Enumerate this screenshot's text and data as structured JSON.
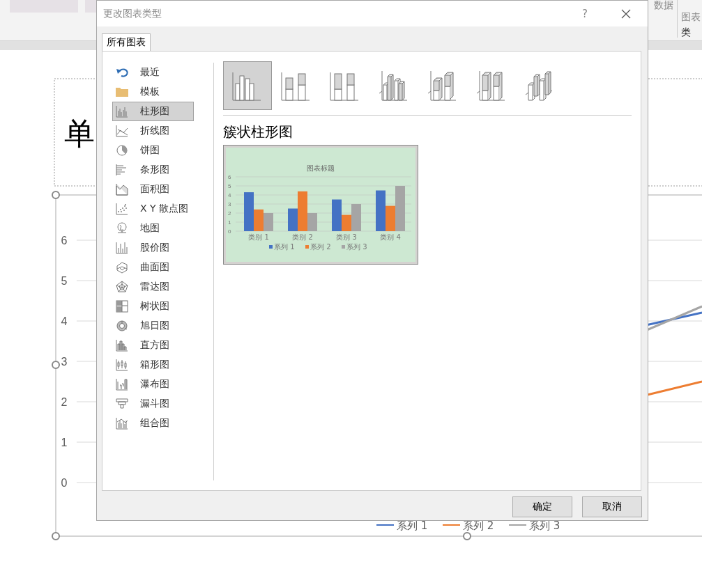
{
  "ribbon": {
    "labels": [
      "数据",
      "图表",
      "类"
    ]
  },
  "slide": {
    "title": "单",
    "y_labels": [
      "6",
      "5",
      "4",
      "3",
      "2",
      "1",
      "0"
    ],
    "legend": [
      {
        "label": "系列 1",
        "color": "#4472c4"
      },
      {
        "label": "系列 2",
        "color": "#ed7d31"
      },
      {
        "label": "系列 3",
        "color": "#a5a5a5"
      }
    ]
  },
  "dialog": {
    "title": "更改图表类型",
    "help": "?",
    "tabs": [
      {
        "label": "所有图表",
        "selected": true
      }
    ],
    "categories": [
      {
        "label": "最近",
        "selected": false
      },
      {
        "label": "模板",
        "selected": false
      },
      {
        "label": "柱形图",
        "selected": true
      },
      {
        "label": "折线图",
        "selected": false
      },
      {
        "label": "饼图",
        "selected": false
      },
      {
        "label": "条形图",
        "selected": false
      },
      {
        "label": "面积图",
        "selected": false
      },
      {
        "label": "X Y 散点图",
        "selected": false
      },
      {
        "label": "地图",
        "selected": false
      },
      {
        "label": "股价图",
        "selected": false
      },
      {
        "label": "曲面图",
        "selected": false
      },
      {
        "label": "雷达图",
        "selected": false
      },
      {
        "label": "树状图",
        "selected": false
      },
      {
        "label": "旭日图",
        "selected": false
      },
      {
        "label": "直方图",
        "selected": false
      },
      {
        "label": "箱形图",
        "selected": false
      },
      {
        "label": "瀑布图",
        "selected": false
      },
      {
        "label": "漏斗图",
        "selected": false
      },
      {
        "label": "组合图",
        "selected": false
      }
    ],
    "subtypes": [
      {
        "selected": true
      },
      {
        "selected": false
      },
      {
        "selected": false
      },
      {
        "selected": false
      },
      {
        "selected": false
      },
      {
        "selected": false
      },
      {
        "selected": false
      }
    ],
    "preview": {
      "heading": "簇状柱形图",
      "chart_data": {
        "type": "bar",
        "title": "图表标题",
        "categories": [
          "类别 1",
          "类别 2",
          "类别 3",
          "类别 4"
        ],
        "series": [
          {
            "name": "系列 1",
            "color": "#4472c4",
            "values": [
              4.3,
              2.5,
              3.5,
              4.5
            ]
          },
          {
            "name": "系列 2",
            "color": "#ed7d31",
            "values": [
              2.4,
              4.4,
              1.8,
              2.8
            ]
          },
          {
            "name": "系列 3",
            "color": "#a5a5a5",
            "values": [
              2,
              2,
              3,
              5
            ]
          }
        ],
        "ylim": [
          0,
          6
        ],
        "yticks": [
          0,
          1,
          2,
          3,
          4,
          5,
          6
        ],
        "grid": true,
        "legend": true
      }
    },
    "buttons": [
      "确定",
      "取消"
    ]
  }
}
